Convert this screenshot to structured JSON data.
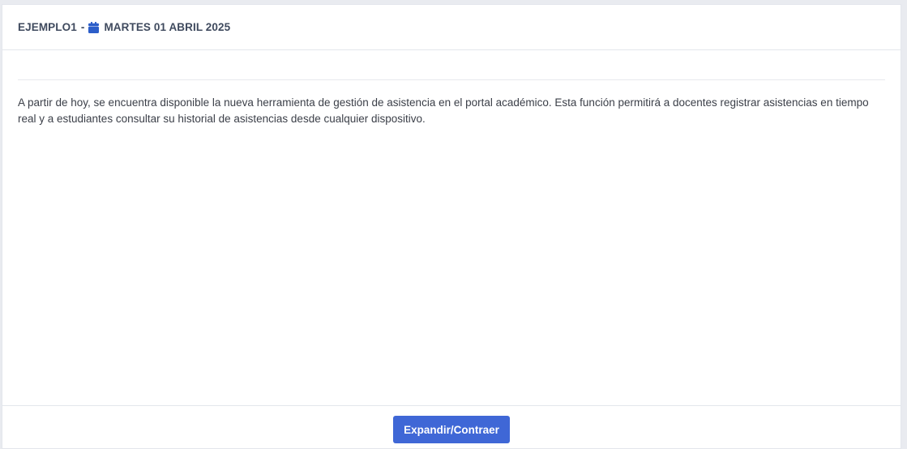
{
  "header": {
    "title": "EJEMPLO1",
    "separator": "-",
    "date_icon": "calendar-icon",
    "date": "MARTES 01 ABRIL 2025"
  },
  "body": {
    "text": "A partir de hoy, se encuentra disponible la nueva herramienta de gestión de asistencia en el portal académico. Esta función permitirá a docentes registrar asistencias en tiempo real y a estudiantes consultar su historial de asistencias desde cualquier dispositivo."
  },
  "footer": {
    "toggle_label": "Expandir/Contraer"
  },
  "colors": {
    "accent": "#3f67d6",
    "header_text": "#3f4a5e",
    "icon": "#2c5ec9"
  }
}
